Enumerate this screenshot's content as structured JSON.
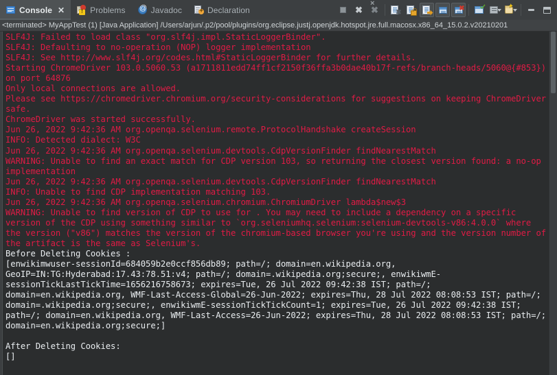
{
  "window": {
    "minimize_label": "Minimize",
    "maximize_label": "Maximize"
  },
  "tabs": [
    {
      "label": "Console",
      "icon": "console-icon",
      "active": true,
      "close_glyph": "✕"
    },
    {
      "label": "Problems",
      "icon": "problems-icon",
      "active": false
    },
    {
      "label": "Javadoc",
      "icon": "javadoc-icon",
      "active": false
    },
    {
      "label": "Declaration",
      "icon": "declaration-icon",
      "active": false
    }
  ],
  "toolbar": {
    "buttons": [
      {
        "name": "terminate-button",
        "title": "Terminate"
      },
      {
        "name": "remove-launch-button",
        "title": "Remove Launch"
      },
      {
        "name": "remove-all-terminated-button",
        "title": "Remove All Terminated Launches"
      },
      {
        "name": "clear-console-button",
        "title": "Clear Console"
      },
      {
        "name": "scroll-lock-button",
        "title": "Scroll Lock"
      },
      {
        "name": "word-wrap-button",
        "title": "Word Wrap"
      },
      {
        "name": "show-console-on-output-button",
        "title": "Show Console When Standard Out Changes"
      },
      {
        "name": "show-console-on-error-button",
        "title": "Show Console When Standard Error Changes"
      },
      {
        "name": "pin-console-button",
        "title": "Pin Console"
      },
      {
        "name": "display-selected-console-button",
        "title": "Display Selected Console"
      },
      {
        "name": "open-console-button",
        "title": "Open Console"
      },
      {
        "name": "minimize-button",
        "title": "Minimize"
      },
      {
        "name": "maximize-button",
        "title": "Maximize"
      }
    ]
  },
  "status": {
    "terminated": "<terminated> MyAppTest (1) [Java Application] /Users/arjun/.p2/pool/plugins/org.eclipse.justj.openjdk.hotspot.jre.full.macosx.x86_64_15.0.2.v20210201"
  },
  "console": {
    "lines": [
      {
        "t": "err",
        "s": "SLF4J: Failed to load class \"org.slf4j.impl.StaticLoggerBinder\"."
      },
      {
        "t": "err",
        "s": "SLF4J: Defaulting to no-operation (NOP) logger implementation"
      },
      {
        "t": "err",
        "s": "SLF4J: See http://www.slf4j.org/codes.html#StaticLoggerBinder for further details."
      },
      {
        "t": "err",
        "s": "Starting ChromeDriver 103.0.5060.53 (a1711811edd74ff1cf2150f36ffa3b0dae40b17f-refs/branch-heads/5060@{#853})"
      },
      {
        "t": "err",
        "s": "on port 64876"
      },
      {
        "t": "err",
        "s": "Only local connections are allowed."
      },
      {
        "t": "err",
        "s": "Please see https://chromedriver.chromium.org/security-considerations for suggestions on keeping ChromeDriver"
      },
      {
        "t": "err",
        "s": "safe."
      },
      {
        "t": "err",
        "s": "ChromeDriver was started successfully."
      },
      {
        "t": "err",
        "s": "Jun 26, 2022 9:42:36 AM org.openqa.selenium.remote.ProtocolHandshake createSession"
      },
      {
        "t": "err",
        "s": "INFO: Detected dialect: W3C"
      },
      {
        "t": "err",
        "s": "Jun 26, 2022 9:42:36 AM org.openqa.selenium.devtools.CdpVersionFinder findNearestMatch"
      },
      {
        "t": "err",
        "s": "WARNING: Unable to find an exact match for CDP version 103, so returning the closest version found: a no-op"
      },
      {
        "t": "err",
        "s": "implementation"
      },
      {
        "t": "err",
        "s": "Jun 26, 2022 9:42:36 AM org.openqa.selenium.devtools.CdpVersionFinder findNearestMatch"
      },
      {
        "t": "err",
        "s": "INFO: Unable to find CDP implementation matching 103."
      },
      {
        "t": "err",
        "s": "Jun 26, 2022 9:42:36 AM org.openqa.selenium.chromium.ChromiumDriver lambda$new$3"
      },
      {
        "t": "err",
        "s": "WARNING: Unable to find version of CDP to use for . You may need to include a dependency on a specific"
      },
      {
        "t": "err",
        "s": "version of the CDP using something similar to `org.seleniumhq.selenium:selenium-devtools-v86:4.0.0` where"
      },
      {
        "t": "err",
        "s": "the version (\"v86\") matches the version of the chromium-based browser you're using and the version number of"
      },
      {
        "t": "err",
        "s": "the artifact is the same as Selenium's."
      },
      {
        "t": "out",
        "s": "Before Deleting Cookies :"
      },
      {
        "t": "out",
        "s": "[enwikimwuser-sessionId=684059b2e0ccf856db89; path=/; domain=en.wikipedia.org,"
      },
      {
        "t": "out",
        "s": "GeoIP=IN:TG:Hyderabad:17.43:78.51:v4; path=/; domain=.wikipedia.org;secure;, enwikiwmE-"
      },
      {
        "t": "out",
        "s": "sessionTickLastTickTime=1656216758673; expires=Tue, 26 Jul 2022 09:42:38 IST; path=/;"
      },
      {
        "t": "out",
        "s": "domain=en.wikipedia.org, WMF-Last-Access-Global=26-Jun-2022; expires=Thu, 28 Jul 2022 08:08:53 IST; path=/;"
      },
      {
        "t": "out",
        "s": "domain=.wikipedia.org;secure;, enwikiwmE-sessionTickTickCount=1; expires=Tue, 26 Jul 2022 09:42:38 IST;"
      },
      {
        "t": "out",
        "s": "path=/; domain=en.wikipedia.org, WMF-Last-Access=26-Jun-2022; expires=Thu, 28 Jul 2022 08:08:53 IST; path=/;"
      },
      {
        "t": "out",
        "s": "domain=en.wikipedia.org;secure;]"
      },
      {
        "t": "out",
        "s": ""
      },
      {
        "t": "out",
        "s": "After Deleting Cookies:"
      },
      {
        "t": "out",
        "s": "[]"
      }
    ]
  },
  "colors": {
    "error_text": "#e01b45",
    "output_text": "#e9edf0",
    "console_bg": "#2b2d2e",
    "chrome_bg": "#3c3f41",
    "active_tab_bg": "#4e5254"
  }
}
